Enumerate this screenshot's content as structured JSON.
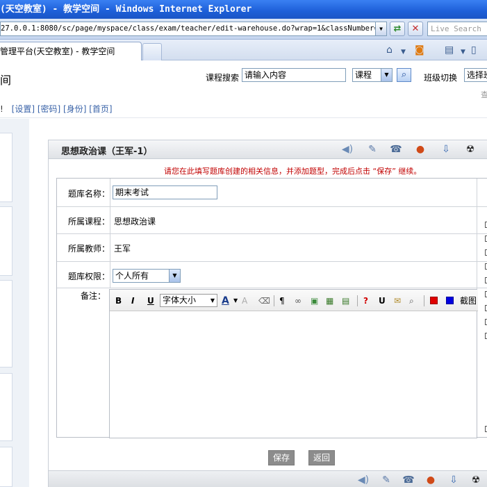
{
  "window": {
    "title": "(天空教室) - 教学空间 - Windows Internet Explorer"
  },
  "browser": {
    "url": "27.0.0.1:8080/sc/page/myspace/class/exam/teacher/edit-warehouse.do?wrap=1&classNumber=(2011-",
    "search_placeholder": "Live Search",
    "tab_title": "管理平台(天空教室) - 教学空间"
  },
  "header": {
    "brand_fragment": "间",
    "course_search_label": "课程搜索",
    "search_placeholder": "请输入内容",
    "search_type": "课程",
    "class_switch_label": "班级切换",
    "class_select_value": "选择班",
    "edge_char": "查",
    "greeting_fragment": "!",
    "links": [
      "[设置]",
      "[密码]",
      "[身份]",
      "[首页]"
    ]
  },
  "panel": {
    "title": "思想政治课（王军-1）",
    "notice": "请您在此填写题库创建的相关信息，并添加题型，完成后点击 “保存” 继续。",
    "form": {
      "name_label": "题库名称：",
      "name_value": "期末考试",
      "course_label": "所属课程：",
      "course_value": "思想政治课",
      "teacher_label": "所属教师：",
      "teacher_value": "王军",
      "permission_label": "题库权限：",
      "permission_value": "个人所有",
      "remarks_label": "备注："
    },
    "editor": {
      "bold": "B",
      "italic": "I",
      "underline": "U",
      "font_size_placeholder": "字体大小",
      "font_color": "A",
      "screenshot_label": "截图"
    },
    "buttons": {
      "save": "保存",
      "back": "返回"
    }
  },
  "icons": {
    "toolbar": [
      "speaker-icon",
      "pen-icon",
      "mailbox-icon",
      "alert-icon",
      "download-icon",
      "radiation-icon"
    ]
  }
}
